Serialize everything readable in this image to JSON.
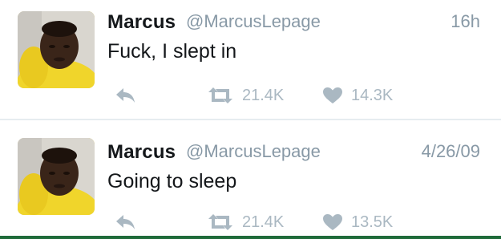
{
  "tweets": [
    {
      "name": "Marcus",
      "handle": "@MarcusLepage",
      "time": "16h",
      "text": "Fuck, I slept in",
      "retweets": "21.4K",
      "likes": "14.3K"
    },
    {
      "name": "Marcus",
      "handle": "@MarcusLepage",
      "time": "4/26/09",
      "text": "Going to sleep",
      "retweets": "21.4K",
      "likes": "13.5K"
    }
  ],
  "icons": {
    "reply": "reply-icon",
    "retweet": "retweet-icon",
    "like": "heart-icon"
  },
  "colors": {
    "icon_gray": "#aab8c2",
    "handle_gray": "#8899a6",
    "avatar_yellow": "#e9d23a"
  }
}
